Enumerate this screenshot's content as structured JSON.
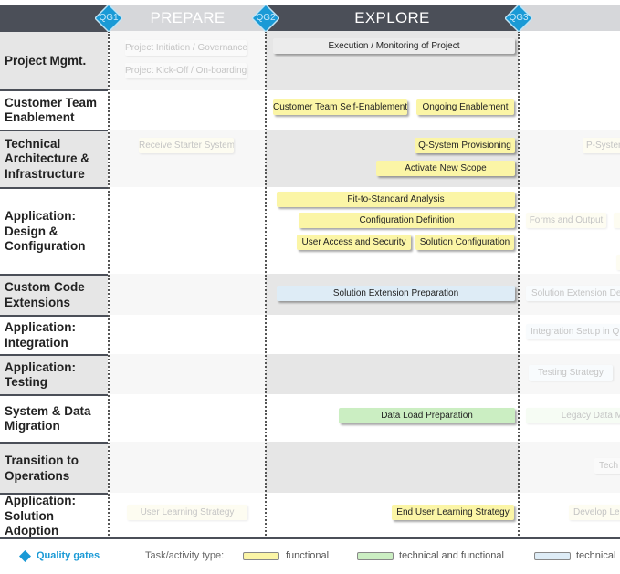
{
  "phases": [
    {
      "id": "prepare",
      "label": "PREPARE",
      "style": "light"
    },
    {
      "id": "explore",
      "label": "EXPLORE",
      "style": "dark"
    },
    {
      "id": "realize",
      "label": "",
      "style": "light"
    }
  ],
  "quality_gates": [
    {
      "label": "QG1"
    },
    {
      "label": "QG2"
    },
    {
      "label": "QG3"
    }
  ],
  "workstreams": [
    {
      "label": "Project Mgmt."
    },
    {
      "label": "Customer Team Enablement"
    },
    {
      "label": "Technical Architecture & Infrastructure"
    },
    {
      "label": "Application: Design & Configuration"
    },
    {
      "label": "Custom Code Extensions"
    },
    {
      "label": "Application: Integration"
    },
    {
      "label": "Application: Testing"
    },
    {
      "label": "System & Data Migration"
    },
    {
      "label": "Transition to Operations"
    },
    {
      "label": "Application: Solution Adoption"
    }
  ],
  "tasks": {
    "prepare": [
      {
        "label": "Project Initiation / Governance",
        "type": "neutral"
      },
      {
        "label": "Project Kick-Off / On-boarding",
        "type": "neutral"
      },
      {
        "label": "Receive Starter System",
        "type": "functional"
      },
      {
        "label": "User Learning Strategy",
        "type": "functional"
      }
    ],
    "explore": [
      {
        "label": "Execution / Monitoring of Project",
        "type": "neutral"
      },
      {
        "label": "Customer Team Self-Enablement",
        "type": "functional"
      },
      {
        "label": "Ongoing Enablement",
        "type": "functional"
      },
      {
        "label": "Q-System Provisioning",
        "type": "functional"
      },
      {
        "label": "Activate New Scope",
        "type": "functional"
      },
      {
        "label": "Fit-to-Standard Analysis",
        "type": "functional"
      },
      {
        "label": "Configuration Definition",
        "type": "functional"
      },
      {
        "label": "User Access and Security",
        "type": "functional"
      },
      {
        "label": "Solution Configuration",
        "type": "functional"
      },
      {
        "label": "Solution Extension Preparation",
        "type": "technical"
      },
      {
        "label": "Data Load Preparation",
        "type": "technical and functional"
      },
      {
        "label": "End User Learning Strategy",
        "type": "functional"
      }
    ],
    "realize": [
      {
        "label": "P-System",
        "type": "functional"
      },
      {
        "label": "Forms and Output",
        "type": "functional"
      },
      {
        "label": "Solution Extension De",
        "type": "technical"
      },
      {
        "label": "Integration Setup in Q",
        "type": "technical"
      },
      {
        "label": "Testing Strategy",
        "type": "technical"
      },
      {
        "label": "Legacy Data M",
        "type": "technical and functional"
      },
      {
        "label": "Tech",
        "type": "neutral"
      },
      {
        "label": "Develop Le",
        "type": "functional"
      }
    ]
  },
  "legend": {
    "quality_gates_label": "Quality gates",
    "task_type_label": "Task/activity type:",
    "types": [
      {
        "label": "functional",
        "color": "#fbf5a6"
      },
      {
        "label": "technical and functional",
        "color": "#cbeec2"
      },
      {
        "label": "technical",
        "color": "#deecf6"
      }
    ]
  },
  "colors": {
    "gate_blue": "#1a9ad6",
    "header_dark": "#4b4f58",
    "header_light": "#d6d7da",
    "legend_blue": "#1a9ad6"
  }
}
